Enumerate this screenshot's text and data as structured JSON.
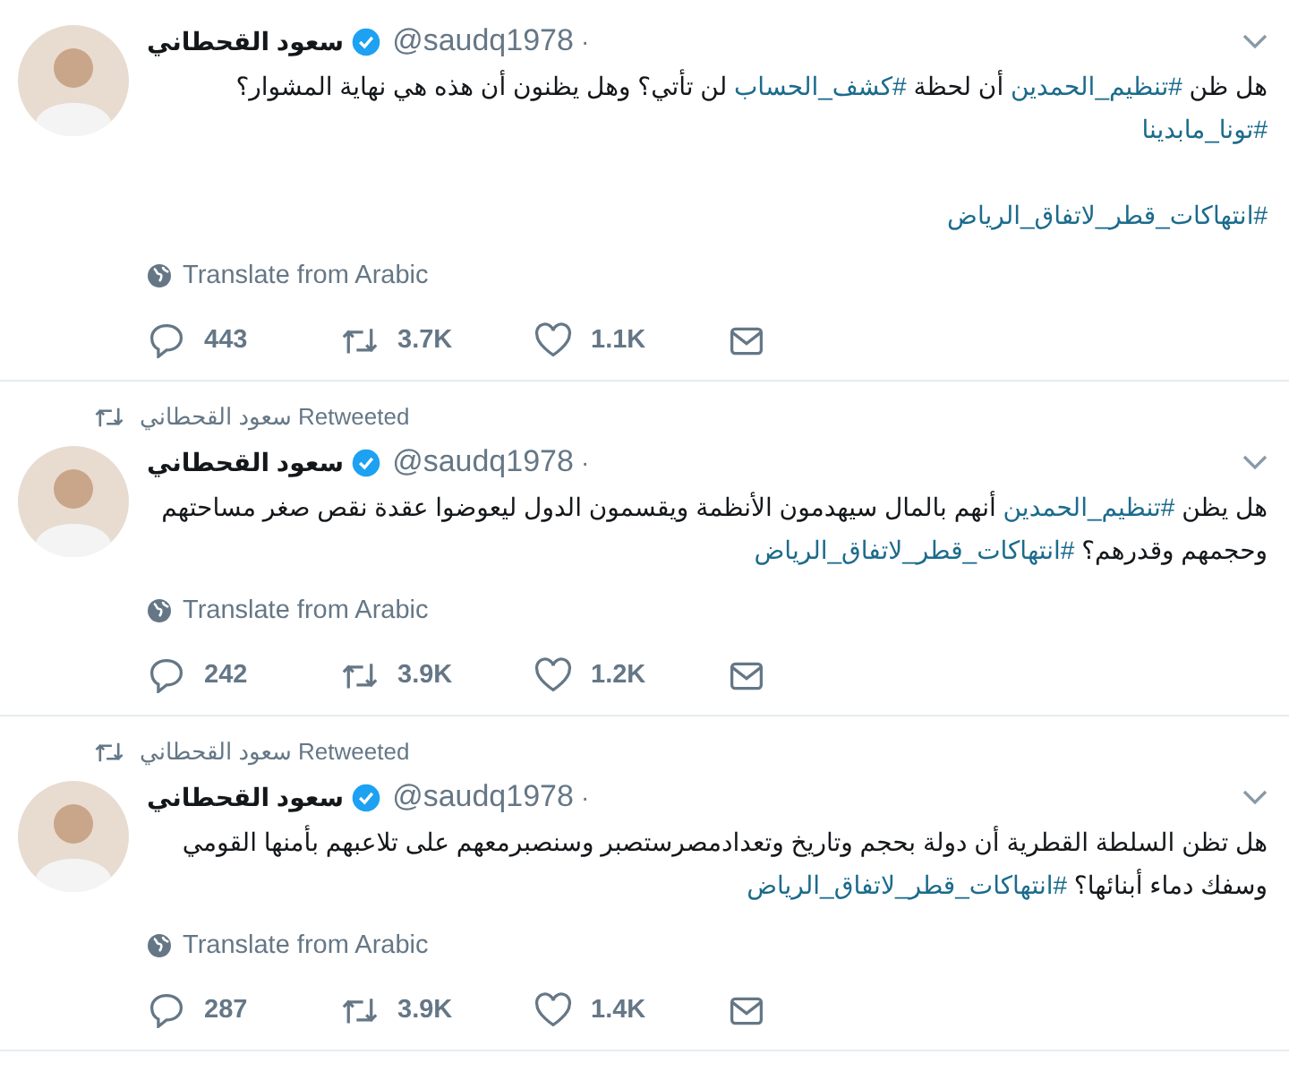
{
  "tweets": [
    {
      "name": "سعود القحطاني",
      "verified": true,
      "handle": "@saudq1978",
      "separator": "·",
      "paragraphs": [
        [
          {
            "parts": [
              {
                "text": "هل ظن ",
                "hashtag": false
              },
              {
                "text": "#تنظيم_الحمدين",
                "hashtag": true
              },
              {
                "text": " أن لحظة ",
                "hashtag": false
              },
              {
                "text": "#كشف_الحساب",
                "hashtag": true
              },
              {
                "text": " لن تأتي؟ وهل يظنون أن هذه هي نهاية المشوار؟",
                "hashtag": false
              }
            ]
          },
          {
            "parts": [
              {
                "text": "#تونا_مابدينا",
                "hashtag": true
              }
            ]
          }
        ],
        [
          {
            "parts": [
              {
                "text": "#انتهاكات_قطر_لاتفاق_الرياض",
                "hashtag": true
              }
            ]
          }
        ]
      ],
      "translate": "Translate from Arabic",
      "replies": "443",
      "retweets": "3.7K",
      "likes": "1.1K"
    },
    {
      "retweet_header": "سعود القحطاني Retweeted",
      "name": "سعود القحطاني",
      "verified": true,
      "handle": "@saudq1978",
      "separator": "·",
      "paragraphs": [
        [
          {
            "parts": [
              {
                "text": "هل يظن ",
                "hashtag": false
              },
              {
                "text": "#تنظيم_الحمدين",
                "hashtag": true
              },
              {
                "text": " أنهم بالمال سيهدمون الأنظمة ويقسمون الدول ليعوضوا عقدة نقص صغر مساحتهم",
                "hashtag": false
              }
            ]
          },
          {
            "parts": [
              {
                "text": "وحجمهم وقدرهم؟ ",
                "hashtag": false
              },
              {
                "text": "#انتهاكات_قطر_لاتفاق_الرياض",
                "hashtag": true
              }
            ]
          }
        ]
      ],
      "translate": "Translate from Arabic",
      "replies": "242",
      "retweets": "3.9K",
      "likes": "1.2K"
    },
    {
      "retweet_header": "سعود القحطاني Retweeted",
      "name": "سعود القحطاني",
      "verified": true,
      "handle": "@saudq1978",
      "separator": "·",
      "paragraphs": [
        [
          {
            "parts": [
              {
                "text": "هل تظن السلطة القطرية أن دولة بحجم وتاريخ وتعدادمصرستصبر وسنصبرمعهم على تلاعبهم بأمنها القومي",
                "hashtag": false
              }
            ]
          },
          {
            "parts": [
              {
                "text": "وسفك دماء أبنائها؟ ",
                "hashtag": false
              },
              {
                "text": "#انتهاكات_قطر_لاتفاق_الرياض",
                "hashtag": true
              }
            ]
          }
        ]
      ],
      "translate": "Translate from Arabic",
      "replies": "287",
      "retweets": "3.9K",
      "likes": "1.4K"
    }
  ]
}
